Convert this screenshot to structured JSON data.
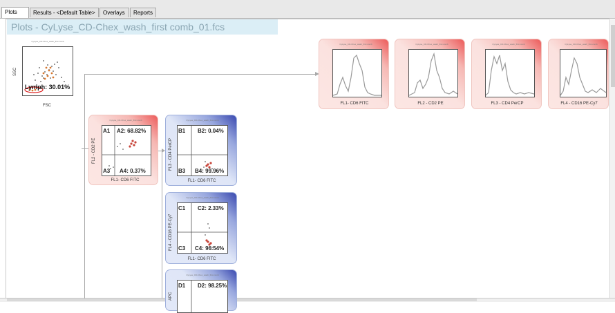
{
  "tabs": [
    {
      "label": "Plots",
      "active": true
    },
    {
      "label": "Results - <Default Table>",
      "active": false
    },
    {
      "label": "Overlays",
      "active": false
    },
    {
      "label": "Reports",
      "active": false
    }
  ],
  "page_title": "Plots - CyLyse_CD-Chex_wash_first comb_01.fcs",
  "scatter_plot": {
    "y_label": "SSC",
    "x_label": "FSC",
    "gate_label": "Lymph: 30.01%"
  },
  "histograms": [
    {
      "x_label": "FL1- CD6 FITC"
    },
    {
      "x_label": "FL2 - CD2 PE"
    },
    {
      "x_label": "FL3 - CD4 PerCP"
    },
    {
      "x_label": "FL4 - CD16 PE-Cy7"
    }
  ],
  "quadrant_plots": [
    {
      "x_label": "FL1- CD6 FITC",
      "y_label": "FL2 - CD2 PE",
      "q1": "A1",
      "q2": "A2: 68.82%",
      "q3": "A3",
      "q4": "A4: 0.37%",
      "style": "red"
    },
    {
      "x_label": "FL1- CD6 FITC",
      "y_label": "FL3 - CD4 PerCP",
      "q1": "B1",
      "q2": "B2: 0.04%",
      "q3": "B3",
      "q4": "B4: 99.96%",
      "style": "blue"
    },
    {
      "x_label": "FL1- CD6 FITC",
      "y_label": "FL4 - CD16 PE-Cy7",
      "q1": "C1",
      "q2": "C2: 2.33%",
      "q3": "C3",
      "q4": "C4: 96.54%",
      "style": "blue"
    },
    {
      "x_label": "",
      "y_label": "APC",
      "q1": "D1",
      "q2": "D2: 98.25%",
      "q3": "",
      "q4": "",
      "style": "blue"
    }
  ],
  "colors": {
    "accent_red": "#ec5a5a",
    "accent_blue": "#3a49b0",
    "title_bg": "#dbeef6"
  }
}
